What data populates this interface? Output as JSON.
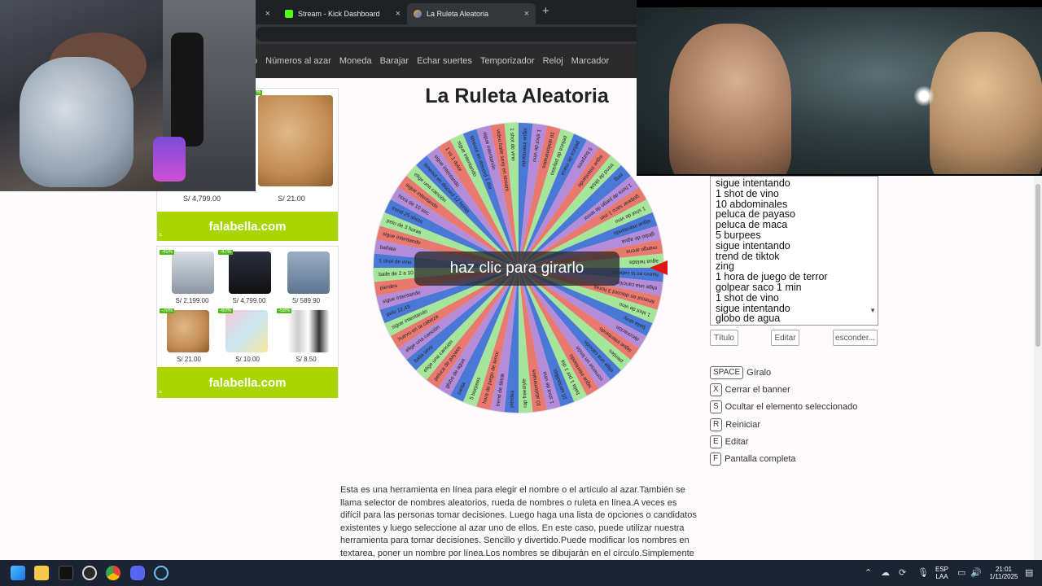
{
  "browser": {
    "tabs": [
      {
        "title": "",
        "close": "×"
      },
      {
        "title": "Stream - Kick Dashboard",
        "close": "×"
      },
      {
        "title": "La Ruleta Aleatoria",
        "close": "×",
        "active": true
      }
    ],
    "new_tab": "+"
  },
  "site_nav": [
    "o",
    "Números al azar",
    "Moneda",
    "Barajar",
    "Echar suertes",
    "Temporizador",
    "Reloj",
    "Marcador"
  ],
  "page": {
    "title": "La Ruleta Aleatoria",
    "spin_label": "haz clic para girarlo"
  },
  "wheel": {
    "segments": [
      "sigue intentando",
      "1 shot de vino",
      "10 abdominales",
      "peluca de payaso",
      "peluca de maca",
      "5 burpees",
      "sigue intentando",
      "trend de tiktok",
      "zing",
      "1 hora de juego de terror",
      "golpear saco 1 min",
      "1 shot de vino",
      "sigue intentando",
      "globo de agua",
      "mango arena",
      "agua helada",
      "huevo en la cabeza",
      "elige una canción",
      "timeout en discord 3 horas",
      "1 shot de vino",
      "baila sexy",
      "decoración",
      "sigue intentando",
      "pierdes",
      "elige una canción",
      "comerse un limón",
      "sigue intentando",
      "baila 1 por 1 día",
      "10 sentadillas",
      "1 shot de vino",
      "10 abdominales",
      "rap freestyle",
      "pierdes",
      "trend de tiktok",
      "hora de juego de terror",
      "5 burpees",
      "canta",
      "globo de agua",
      "peluca de payaso",
      "elige una canción",
      "baila sexy",
      "elige una canción",
      "huevo en la cabeza",
      "sigue intentando",
      "pelo 12,43",
      "sigue intentando",
      "pierdes",
      "baile de 2 a 10",
      "1 shot de vino",
      "bañate",
      "sigue intentando",
      "pelo de 3 horas",
      "trend 25 shots",
      "hora de 10 sec",
      "sigue intentando",
      "elige una canción",
      "timeout en discord 12 horas",
      "sigue intentando",
      "1 vs 1 dolor",
      "sigue intentando",
      "timeout en discord 1 día",
      "sigue intentando",
      "video baile sexy en stream",
      "1 shot de vino"
    ],
    "colors": [
      "#4a78d6",
      "#b58cd9",
      "#e9796f",
      "#a6e69a"
    ]
  },
  "ads": {
    "top": {
      "prices": [
        "S/ 4,799.00",
        "S/ 21.00"
      ],
      "brand": "falabella.com",
      "corner": "="
    },
    "bottom": {
      "items": [
        {
          "badge": "-45%",
          "price": "S/ 2,199.00"
        },
        {
          "badge": "-47%",
          "price": "S/ 4,799.00"
        },
        {
          "badge": "",
          "price": "S/ 589.90"
        },
        {
          "badge": "-70%",
          "price": "S/ 21.00"
        },
        {
          "badge": "-60%",
          "price": "S/ 10.00"
        },
        {
          "badge": "-58%",
          "price": "S/ 8.50"
        }
      ],
      "brand": "falabella.com",
      "corner": "="
    }
  },
  "options_textarea": [
    "sigue intentando",
    "1 shot de vino",
    "10 abdominales",
    "peluca de payaso",
    "peluca de maca",
    "5 burpees",
    "sigue intentando",
    "trend de tiktok",
    "zing",
    "1 hora de juego de terror",
    "golpear saco 1 min",
    "1 shot de vino",
    "sigue intentando",
    "globo de agua"
  ],
  "controls": {
    "title_btn": "Título",
    "edit_btn": "Editar",
    "hide_btn": "esconder..."
  },
  "shortcuts": [
    {
      "key": "SPACE",
      "label": "Gíralo"
    },
    {
      "key": "X",
      "label": "Cerrar el banner"
    },
    {
      "key": "S",
      "label": "Ocultar el elemento seleccionado"
    },
    {
      "key": "R",
      "label": "Reiniciar"
    },
    {
      "key": "E",
      "label": "Editar"
    },
    {
      "key": "F",
      "label": "Pantalla completa"
    }
  ],
  "description": "Esta es una herramienta en línea para elegir el nombre o el artículo al azar.También se llama selector de nombres aleatorios, rueda de nombres o ruleta en línea.A veces es difícil para las personas tomar decisiones. Luego haga una lista de opciones o candidatos existentes y luego seleccione al azar uno de ellos. En este caso, puede utilizar nuestra herramienta para tomar decisiones. Sencillo y divertido.Puede modificar los nombres en textarea, poner un nombre por línea.Los nombres se dibujarán en el círculo.Simplemente haga clic en la rueda",
  "taskbar": {
    "lang": "ESP",
    "lang2": "LAA",
    "time": "21:01",
    "date": "1/11/2025"
  }
}
